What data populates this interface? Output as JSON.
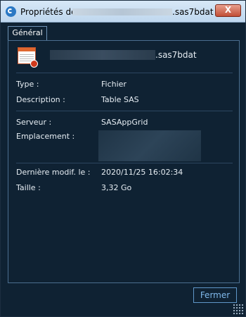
{
  "window": {
    "title_prefix": "Propriétés de",
    "title_suffix": ".sas7bdat",
    "close_label": "X"
  },
  "tabs": [
    {
      "label": "Général"
    }
  ],
  "file": {
    "name_suffix": ".sas7bdat",
    "icon": "sas-table-icon"
  },
  "properties": {
    "type_label": "Type :",
    "type_value": "Fichier",
    "description_label": "Description :",
    "description_value": "Table SAS",
    "server_label": "Serveur :",
    "server_value": "SASAppGrid",
    "location_label": "Emplacement :",
    "modified_label": "Dernière modif. le :",
    "modified_value": "2020/11/25 16:02:34",
    "size_label": "Taille :",
    "size_value": "3,32 Go"
  },
  "buttons": {
    "close_label": "Fermer"
  },
  "colors": {
    "background": "#0f2233",
    "accent": "#5f97c9",
    "titlebar": "#cfe2f3"
  }
}
